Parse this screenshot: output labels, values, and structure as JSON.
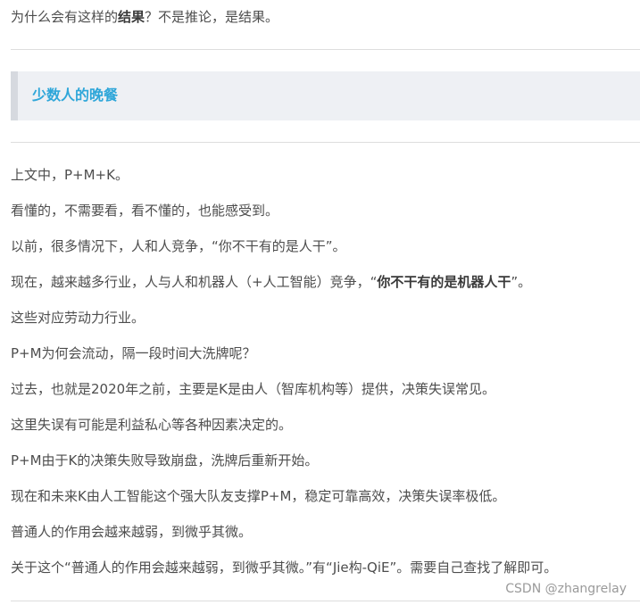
{
  "intro": {
    "before": "为什么会有这样的",
    "bold": "结果",
    "after": "？不是推论，是结果。"
  },
  "section": {
    "heading": "少数人的晚餐"
  },
  "paragraphs": {
    "p1": "上文中，P+M+K。",
    "p2": "看懂的，不需要看，看不懂的，也能感受到。",
    "p3": "以前，很多情况下，人和人竞争，“你不干有的是人干”。",
    "p4_before": "现在，越来越多行业，人与人和机器人（+人工智能）竞争，“",
    "p4_bold": "你不干有的是机器人干",
    "p4_after": "”。",
    "p5": "这些对应劳动力行业。",
    "p6": "P+M为何会流动，隔一段时间大洗牌呢？",
    "p7": "过去，也就是2020年之前，主要是K是由人（智库机构等）提供，决策失误常见。",
    "p8": "这里失误有可能是利益私心等各种因素决定的。",
    "p9": "P+M由于K的决策失败导致崩盘，洗牌后重新开始。",
    "p10": "现在和未来K由人工智能这个强大队友支撑P+M，稳定可靠高效，决策失误率极低。",
    "p11": "普通人的作用会越来越弱，到微乎其微。",
    "p12": "关于这个“普通人的作用会越来越弱，到微乎其微。”有“Jie构-QiE”。需要自己查找了解即可。"
  },
  "watermark": "CSDN @zhangrelay",
  "colors": {
    "text": "#4d4d4d",
    "heading_accent": "#2ea6d9",
    "heading_bg": "#eef0f4",
    "heading_border": "#d6d9df",
    "divider": "#dddddd",
    "watermark": "#9a9a9a"
  }
}
